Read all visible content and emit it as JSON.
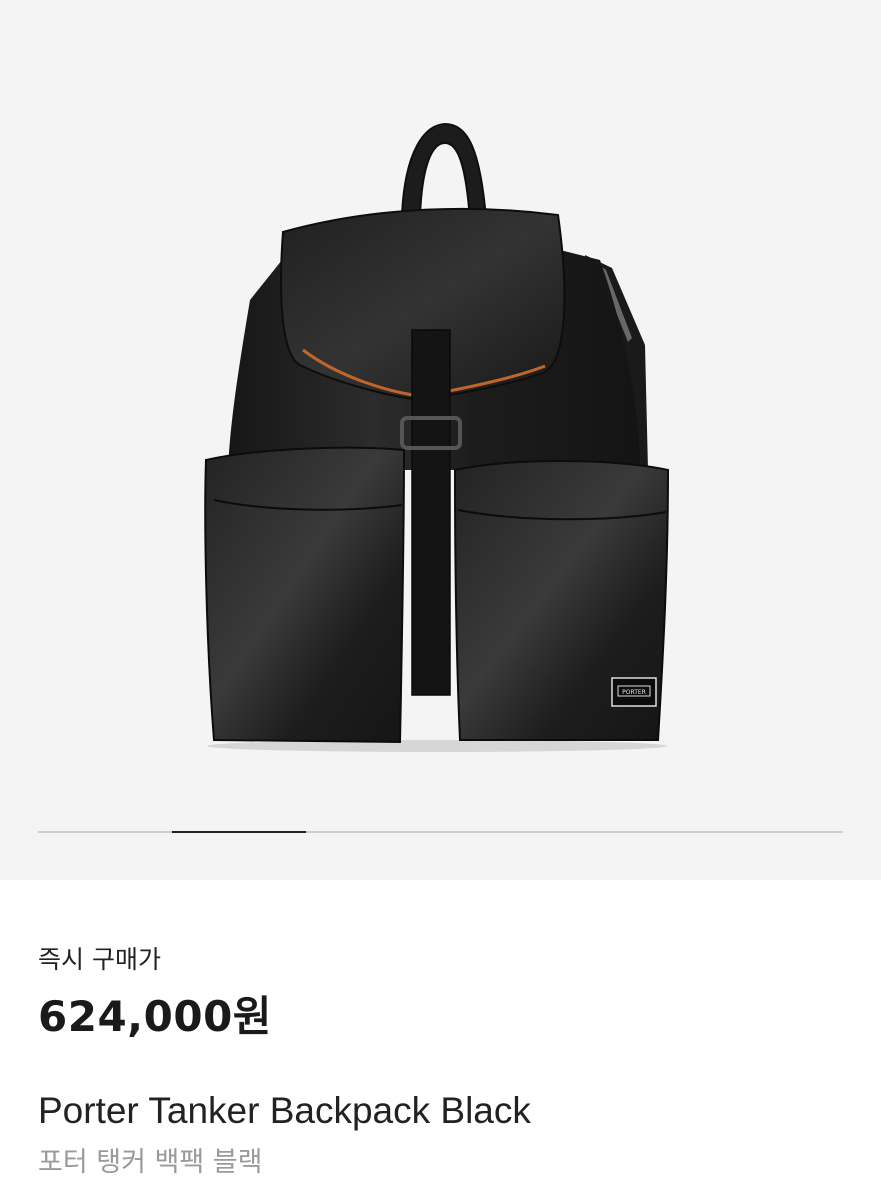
{
  "product": {
    "image_alt": "Porter Tanker Backpack Black",
    "brand_patch": "PORTER",
    "gallery": {
      "current_index": 1,
      "total": 6
    },
    "price_label": "즉시 구매가",
    "price": "624,000원",
    "name_en": "Porter Tanker Backpack Black",
    "name_ko": "포터 탱커 백팩 블랙"
  },
  "colors": {
    "hero_bg": "#f4f4f4",
    "bag": "#1e1e1e",
    "bag_highlight": "#3a3a3a",
    "trim_orange": "#c0662a",
    "text_primary": "#222222",
    "text_secondary": "#9a9a9a"
  }
}
